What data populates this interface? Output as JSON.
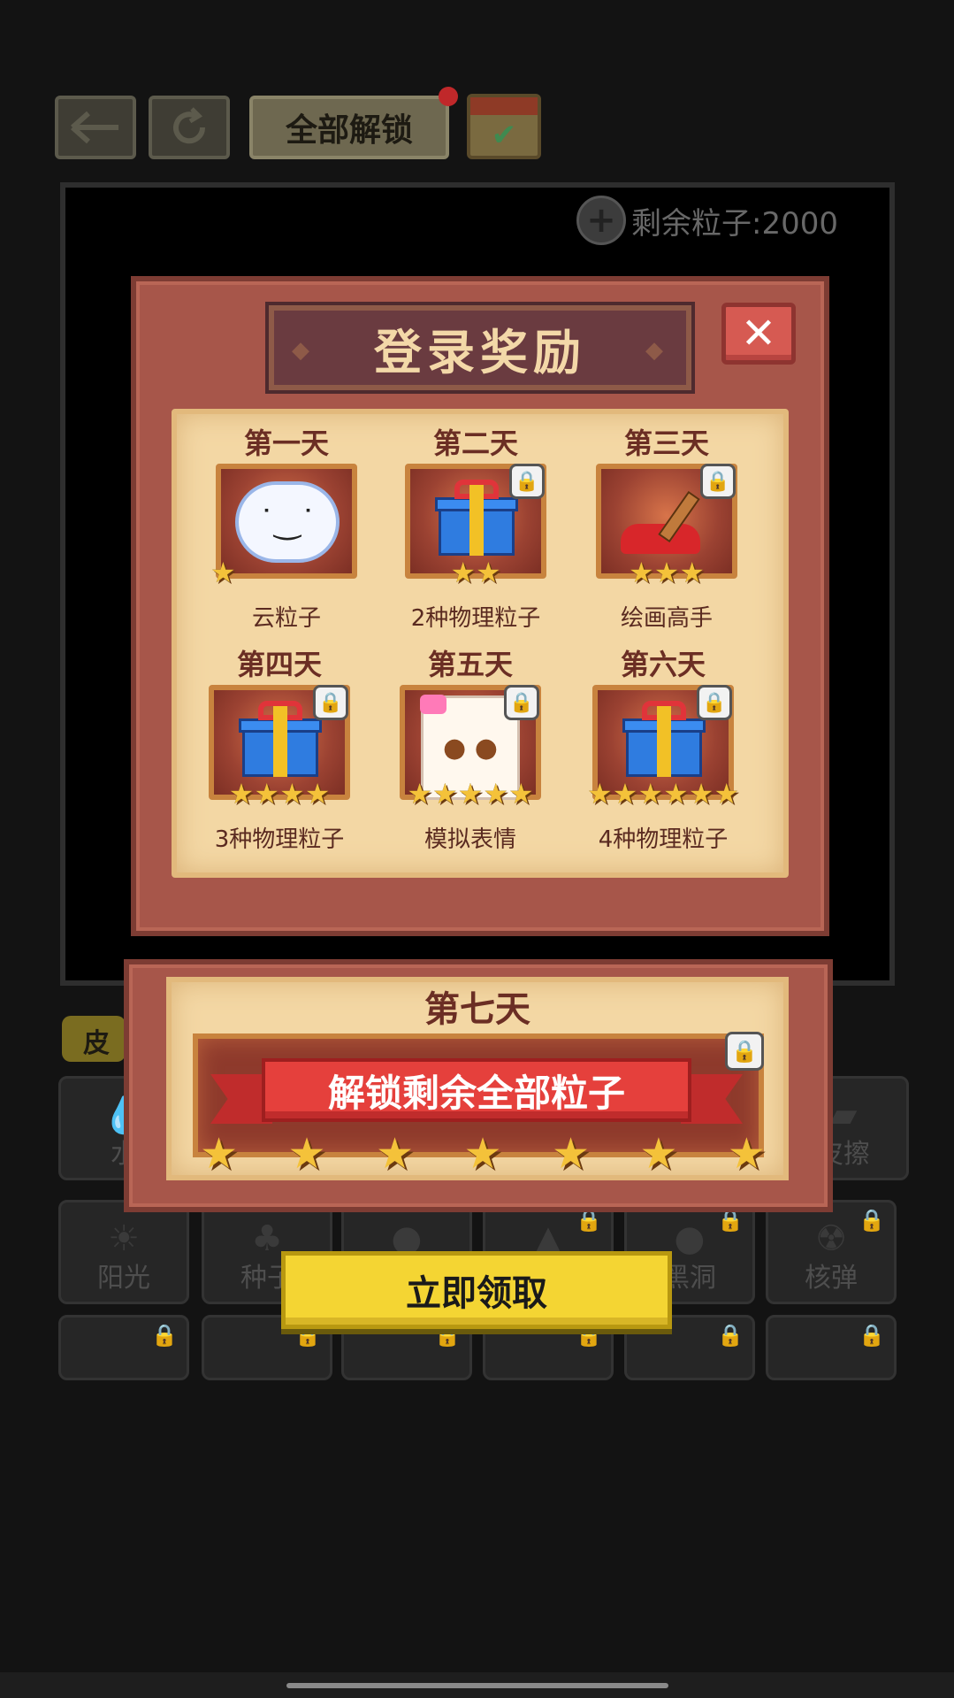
{
  "toolbar": {
    "unlock_all_label": "全部解锁",
    "back_icon": "arrow-left-icon",
    "refresh_icon": "refresh-icon",
    "calendar_icon": "calendar-check-icon"
  },
  "board": {
    "particles_label": "剩余粒子:2000"
  },
  "skin_tab": {
    "label": "皮"
  },
  "tools": [
    {
      "label": "水",
      "icon": "water-icon"
    },
    {
      "label": "",
      "icon": "blank"
    },
    {
      "label": "",
      "icon": "blank"
    },
    {
      "label": "",
      "icon": "blank"
    },
    {
      "label": "",
      "icon": "blank"
    },
    {
      "label": "皮擦",
      "icon": "eraser-icon"
    },
    {
      "label": "阳光",
      "icon": "sun-icon"
    },
    {
      "label": "种子",
      "icon": "seed-icon"
    },
    {
      "label": "",
      "icon": "bird-icon"
    },
    {
      "label": "",
      "icon": "wizard-icon"
    },
    {
      "label": "黑洞",
      "icon": "blackhole-icon"
    },
    {
      "label": "核弹",
      "icon": "nuke-icon"
    }
  ],
  "dialog": {
    "title": "登录奖励",
    "close_icon": "close-icon",
    "days": [
      {
        "title": "第一天",
        "label": "云粒子",
        "stars": "★",
        "locked": false
      },
      {
        "title": "第二天",
        "label": "2种物理粒子",
        "stars": "★★",
        "locked": true
      },
      {
        "title": "第三天",
        "label": "绘画高手",
        "stars": "★★★",
        "locked": true
      },
      {
        "title": "第四天",
        "label": "3种物理粒子",
        "stars": "★★★★",
        "locked": true
      },
      {
        "title": "第五天",
        "label": "模拟表情",
        "stars": "★★★★★",
        "locked": true
      },
      {
        "title": "第六天",
        "label": "4种物理粒子",
        "stars": "★★★★★★",
        "locked": true
      }
    ],
    "seventh": {
      "title": "第七天",
      "banner": "解锁剩余全部粒子",
      "stars": "★★★★★★★"
    },
    "claim_label": "立即领取"
  },
  "colors": {
    "panel": "#a7564a",
    "parchment": "#f3d7a4",
    "claim": "#f4d533",
    "close": "#d65a52"
  }
}
